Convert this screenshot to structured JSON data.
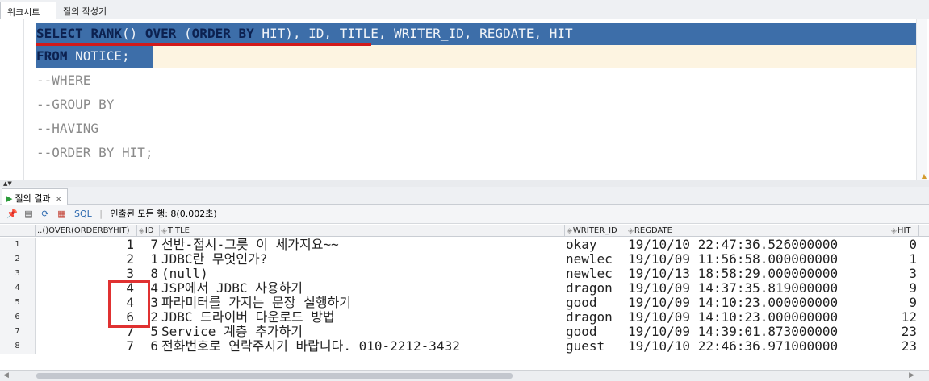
{
  "top_tabs": [
    {
      "label": "워크시트"
    },
    {
      "label": "질의 작성기"
    }
  ],
  "editor": {
    "lines": [
      {
        "kw1": "SELECT",
        "kw2": "RANK",
        "mid1": "() ",
        "kw3": "OVER",
        "mid2": " (",
        "kw4": "ORDER BY",
        "rest": " HIT), ID, TITLE, WRITER_ID, REGDATE, HIT"
      },
      {
        "kw1": "FROM",
        "rest": " NOTICE;"
      },
      {
        "text": "--WHERE"
      },
      {
        "text": "--GROUP BY"
      },
      {
        "text": "--HAVING"
      },
      {
        "text": "--ORDER BY HIT;"
      }
    ]
  },
  "result_tab": {
    "label": "질의 결과",
    "close": "×"
  },
  "toolbar": {
    "sql_label": "SQL",
    "status": "인출된 모든 행: 8(0.002초)"
  },
  "grid": {
    "columns": [
      {
        "label": "..()OVER(ORDERBYHIT)"
      },
      {
        "label": "ID"
      },
      {
        "label": "TITLE"
      },
      {
        "label": "WRITER_ID"
      },
      {
        "label": "REGDATE"
      },
      {
        "label": "HIT"
      }
    ],
    "rows": [
      {
        "num": "1",
        "rank": "1",
        "id": "7",
        "title": "선반-접시-그릇 이 세가지요~~",
        "writer": "okay",
        "regdate": "19/10/10 22:47:36.526000000",
        "hit": "0"
      },
      {
        "num": "2",
        "rank": "2",
        "id": "1",
        "title": "JDBC란 무엇인가?",
        "writer": "newlec",
        "regdate": "19/10/09 11:56:58.000000000",
        "hit": "1"
      },
      {
        "num": "3",
        "rank": "3",
        "id": "8",
        "title": "(null)",
        "writer": "newlec",
        "regdate": "19/10/13 18:58:29.000000000",
        "hit": "3"
      },
      {
        "num": "4",
        "rank": "4",
        "id": "4",
        "title": "JSP에서 JDBC 사용하기",
        "writer": "dragon",
        "regdate": "19/10/09 14:37:35.819000000",
        "hit": "9"
      },
      {
        "num": "5",
        "rank": "4",
        "id": "3",
        "title": "파라미터를 가지는 문장 실행하기",
        "writer": "good",
        "regdate": "19/10/09 14:10:23.000000000",
        "hit": "9"
      },
      {
        "num": "6",
        "rank": "6",
        "id": "2",
        "title": "JDBC 드라이버 다운로드 방법",
        "writer": "dragon",
        "regdate": "19/10/09 14:10:23.000000000",
        "hit": "12"
      },
      {
        "num": "7",
        "rank": "7",
        "id": "5",
        "title": "Service 계층 추가하기",
        "writer": "good",
        "regdate": "19/10/09 14:39:01.873000000",
        "hit": "23"
      },
      {
        "num": "8",
        "rank": "7",
        "id": "6",
        "title": "전화번호로 연락주시기 바랍니다. 010-2212-3432",
        "writer": "guest",
        "regdate": "19/10/10 22:46:36.971000000",
        "hit": "23"
      }
    ]
  },
  "colors": {
    "selection": "#3d6ea9",
    "highlight_box": "#e03131",
    "underline": "#d21a1a"
  }
}
